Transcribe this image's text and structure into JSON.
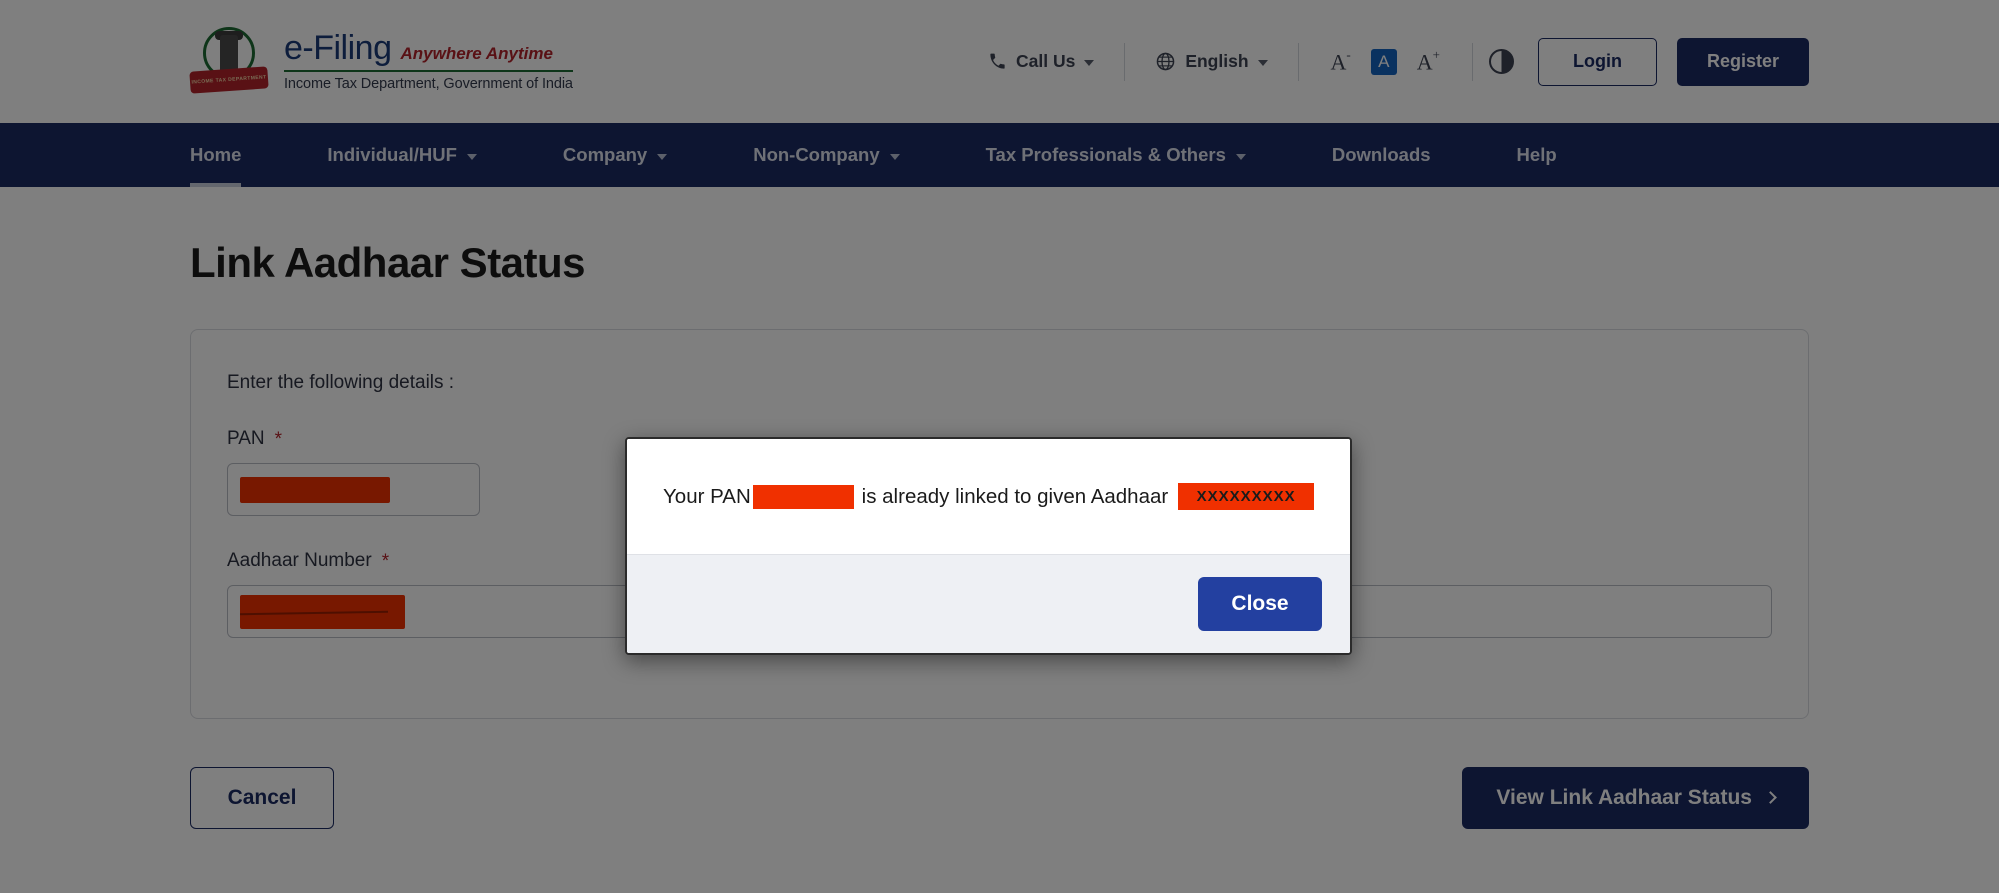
{
  "header": {
    "brand": {
      "emblem_alt": "india-emblem",
      "ribbon_text": "INCOME TAX DEPARTMENT",
      "title": "e-Filing",
      "tagline": "Anywhere Anytime",
      "department": "Income Tax Department, Government of India"
    },
    "call_us": "Call Us",
    "language": "English",
    "font_decrease": "A",
    "font_decrease_sup": "-",
    "font_normal": "A",
    "font_increase": "A",
    "font_increase_sup": "+",
    "login": "Login",
    "register": "Register"
  },
  "nav": {
    "items": [
      {
        "label": "Home",
        "has_caret": false,
        "active": true
      },
      {
        "label": "Individual/HUF",
        "has_caret": true,
        "active": false
      },
      {
        "label": "Company",
        "has_caret": true,
        "active": false
      },
      {
        "label": "Non-Company",
        "has_caret": true,
        "active": false
      },
      {
        "label": "Tax Professionals & Others",
        "has_caret": true,
        "active": false
      },
      {
        "label": "Downloads",
        "has_caret": false,
        "active": false
      },
      {
        "label": "Help",
        "has_caret": false,
        "active": false
      }
    ]
  },
  "main": {
    "page_title": "Link Aadhaar Status",
    "card_intro": "Enter the following details :",
    "fields": [
      {
        "label": "PAN",
        "required_mark": "*",
        "value": "",
        "redacted": true
      },
      {
        "label": "Aadhaar Number",
        "required_mark": "*",
        "value": "",
        "redacted": true
      }
    ],
    "cancel_button": "Cancel",
    "view_button": "View Link Aadhaar Status"
  },
  "modal": {
    "message_prefix": "Your PAN",
    "message_middle": "is already linked to given Aadhaar",
    "aadhaar_masked": "XXXXXXXXX",
    "close_button": "Close"
  },
  "colors": {
    "brand_navy": "#1b2a63",
    "accent_red": "#b3232b",
    "green_rule": "#1c6b33",
    "redaction": "#f03000",
    "modal_button": "#2340a0",
    "highlight_blue": "#1565c0"
  }
}
